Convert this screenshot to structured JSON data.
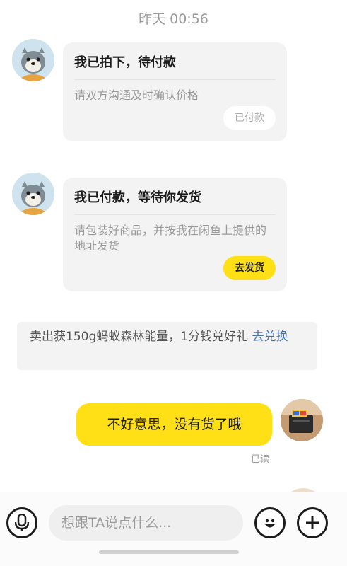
{
  "chat": {
    "timestamp": "昨天 00:56",
    "cards": [
      {
        "title": "我已拍下，待付款",
        "desc": "请双方沟通及时确认价格",
        "button": "已付款"
      },
      {
        "title": "我已付款，等待你发货",
        "desc": "请包装好商品，并按我在闲鱼上提供的地址发货",
        "button": "去发货"
      }
    ],
    "system_note": {
      "text": "卖出获150g蚂蚁森林能量，1分钱兑好礼 ",
      "link": "去兑换"
    },
    "my_message": "不好意思，没有货了哦",
    "read_status": "已读"
  },
  "input_bar": {
    "placeholder": "想跟TA说点什么..."
  },
  "colors": {
    "accent": "#ffe017",
    "card_bg": "#f3f3f3",
    "link": "#4b72a8",
    "muted": "#9a9a9a"
  },
  "icons": [
    "seal-avatar-icon",
    "microphone-icon",
    "emoji-icon",
    "plus-icon"
  ]
}
